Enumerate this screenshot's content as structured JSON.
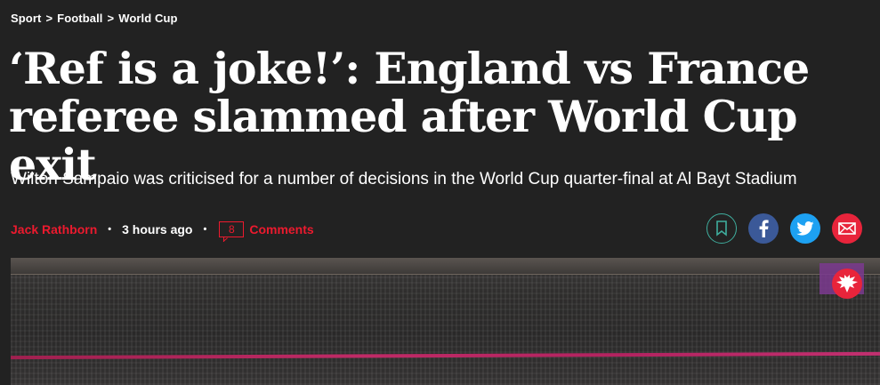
{
  "breadcrumb": {
    "items": [
      "Sport",
      "Football",
      "World Cup"
    ],
    "separator": ">"
  },
  "headline": {
    "line1": "‘Ref is a joke!’: England vs France",
    "line2": "referee slammed after World Cup exit"
  },
  "subtitle": "Wilton Sampaio was criticised for a number of decisions in the World Cup quarter-final at Al Bayt Stadium",
  "byline": {
    "author": "Jack Rathborn",
    "time": "3 hours ago",
    "separator": "•",
    "comment_count": "8",
    "comments_label": "Comments"
  },
  "share": {
    "icons": [
      "bookmark-icon",
      "facebook-icon",
      "twitter-icon",
      "email-icon"
    ]
  },
  "colors": {
    "background": "#222222",
    "accent_red": "#ec1a2e",
    "facebook": "#3b5998",
    "twitter": "#1da1f2",
    "email": "#e8243b",
    "bookmark": "#3fae9e"
  }
}
